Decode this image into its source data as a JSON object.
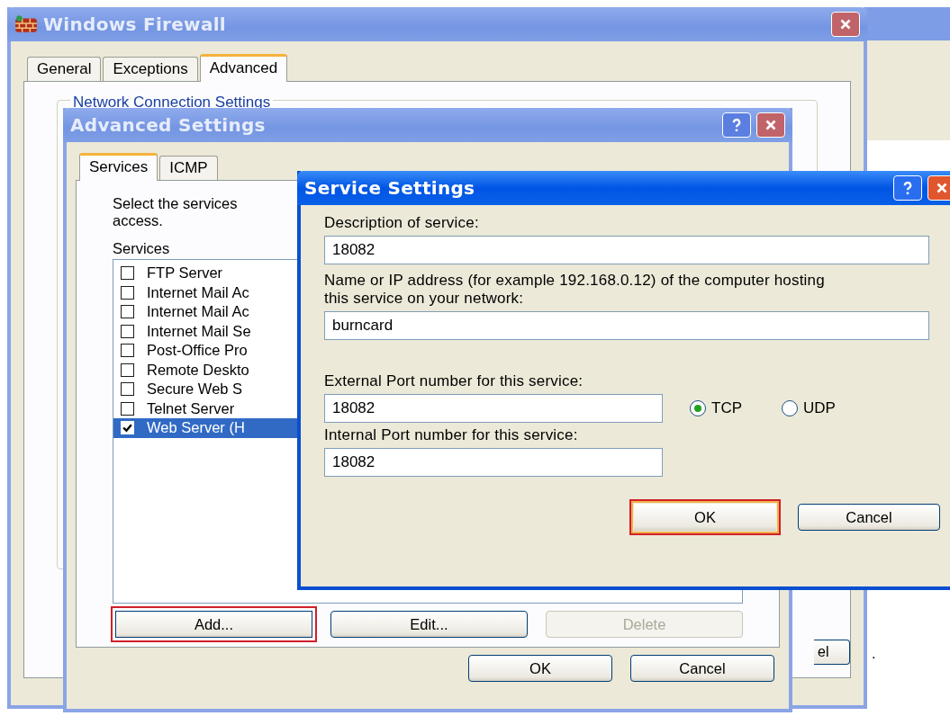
{
  "firewall_window": {
    "title": "Windows Firewall",
    "tabs": [
      {
        "label": "General",
        "selected": false
      },
      {
        "label": "Exceptions",
        "selected": false
      },
      {
        "label": "Advanced",
        "selected": true
      }
    ],
    "group_title": "Network Connection Settings",
    "button_fragment": "el",
    "stray_mark": "."
  },
  "advanced_window": {
    "title": "Advanced Settings",
    "tabs": [
      {
        "label": "Services",
        "selected": true
      },
      {
        "label": "ICMP",
        "selected": false
      }
    ],
    "intro": [
      "Select the services",
      "access."
    ],
    "list_label": "Services",
    "services": [
      {
        "label": "FTP Server",
        "checked": false,
        "selected": false
      },
      {
        "label": "Internet Mail Ac",
        "checked": false,
        "selected": false
      },
      {
        "label": "Internet Mail Ac",
        "checked": false,
        "selected": false
      },
      {
        "label": "Internet Mail Se",
        "checked": false,
        "selected": false
      },
      {
        "label": "Post-Office Pro",
        "checked": false,
        "selected": false
      },
      {
        "label": "Remote Deskto",
        "checked": false,
        "selected": false
      },
      {
        "label": "Secure Web S",
        "checked": false,
        "selected": false
      },
      {
        "label": "Telnet Server",
        "checked": false,
        "selected": false
      },
      {
        "label": "Web Server (H",
        "checked": true,
        "selected": true
      }
    ],
    "buttons": [
      {
        "label": "Add...",
        "highlighted": true,
        "disabled": false
      },
      {
        "label": "Edit...",
        "highlighted": false,
        "disabled": false
      },
      {
        "label": "Delete",
        "highlighted": false,
        "disabled": true
      }
    ],
    "footer_buttons": [
      {
        "label": "OK"
      },
      {
        "label": "Cancel"
      }
    ]
  },
  "service_window": {
    "title": "Service Settings",
    "description_label": "Description of service:",
    "description": "18082",
    "host_label": "Name or IP address (for example 192.168.0.12) of the computer hosting this service on your network:",
    "host": "burncard",
    "external_label": "External Port number for this service:",
    "external_port": "18082",
    "protocols": [
      {
        "label": "TCP",
        "selected": true
      },
      {
        "label": "UDP",
        "selected": false
      }
    ],
    "internal_label": "Internal Port number for this service:",
    "internal_port": "18082",
    "buttons": [
      {
        "label": "OK",
        "highlighted": true
      },
      {
        "label": "Cancel",
        "highlighted": false
      }
    ]
  }
}
